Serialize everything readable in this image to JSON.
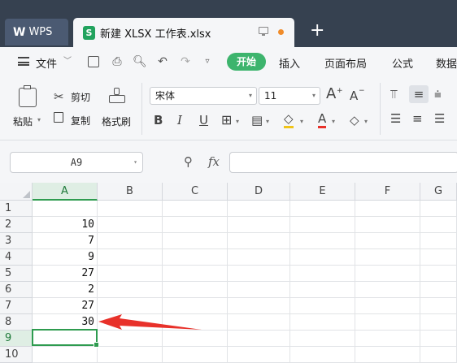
{
  "titlebar": {
    "wps_tab": "WPS",
    "file_tab": "新建 XLSX 工作表.xlsx",
    "new_tab": "+"
  },
  "menubar": {
    "file_menu": "文件",
    "tabs": [
      "开始",
      "插入",
      "页面布局",
      "公式",
      "数据"
    ]
  },
  "ribbon": {
    "paste": "粘贴",
    "cut": "剪切",
    "copy": "复制",
    "format_painter": "格式刷",
    "font_name": "宋体",
    "font_size": "11",
    "bold": "B",
    "italic": "I",
    "underline": "U",
    "grow_font": "A",
    "shrink_font": "A",
    "font_color": "A"
  },
  "formula_bar": {
    "name_box": "A9",
    "fx": "fx",
    "formula": ""
  },
  "grid": {
    "columns": [
      "A",
      "B",
      "C",
      "D",
      "E",
      "F",
      "G"
    ],
    "rows": [
      "1",
      "2",
      "3",
      "4",
      "5",
      "6",
      "7",
      "8",
      "9",
      "10"
    ],
    "column_a_values": [
      "",
      "10",
      "7",
      "9",
      "27",
      "2",
      "27",
      "30",
      "",
      ""
    ],
    "selected_cell": "A9"
  },
  "annotation": {
    "arrow_color": "#e8312a"
  },
  "colors": {
    "accent": "#3db46d",
    "titlebar": "#364150"
  }
}
